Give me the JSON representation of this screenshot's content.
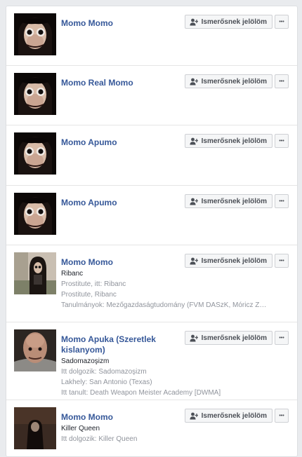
{
  "labels": {
    "add_friend": "Ismerősnek jelölöm",
    "more": "•••"
  },
  "people": [
    {
      "name": "Momo Momo",
      "avatar": "momo-face-avatar"
    },
    {
      "name": "Momo Real Momo",
      "avatar": "momo-face-avatar"
    },
    {
      "name": "Momo Apumo",
      "avatar": "momo-face-avatar"
    },
    {
      "name": "Momo Apumo",
      "avatar": "momo-face-avatar"
    },
    {
      "name": "Momo Momo",
      "avatar": "momo-doll-photo-avatar",
      "line1": "Ribanc",
      "details": [
        "Prostitute, itt: Ribanc",
        "Prostitute, Ribanc",
        "Tanulmányok: Mezőgazdaságtudomány (FVM DASzK, Móricz Zsigmon..."
      ]
    },
    {
      "name": "Momo Apuka (Szeretlek kislanyom)",
      "avatar": "distorted-face-avatar",
      "line1": "Sadomazoşizm",
      "details": [
        "Itt dolgozik: Sadomazoşizm",
        "Lakhely: San Antonio (Texas)",
        "Itt tanult: Death Weapon Meister Academy [DWMA]"
      ]
    },
    {
      "name": "Momo Momo",
      "avatar": "dark-figure-avatar",
      "line1": "Killer Queen",
      "details": [
        "Itt dolgozik: Killer Queen"
      ]
    }
  ]
}
